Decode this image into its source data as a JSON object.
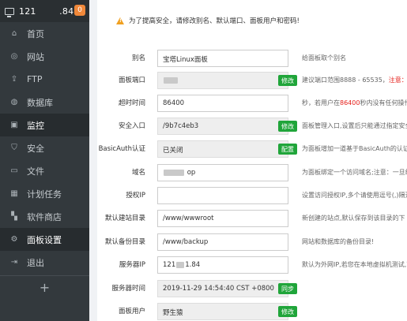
{
  "header": {
    "ip": "121        .84",
    "badge": "0"
  },
  "nav": [
    {
      "label": "首页",
      "icon": "home-icon"
    },
    {
      "label": "网站",
      "icon": "globe-icon"
    },
    {
      "label": "FTP",
      "icon": "upload-icon"
    },
    {
      "label": "数据库",
      "icon": "database-icon"
    },
    {
      "label": "监控",
      "icon": "monitor-icon"
    },
    {
      "label": "安全",
      "icon": "shield-icon"
    },
    {
      "label": "文件",
      "icon": "folder-icon"
    },
    {
      "label": "计划任务",
      "icon": "calendar-icon"
    },
    {
      "label": "软件商店",
      "icon": "grid-icon"
    },
    {
      "label": "面板设置",
      "icon": "gear-icon"
    },
    {
      "label": "退出",
      "icon": "logout-icon"
    }
  ],
  "add_symbol": "+",
  "warning": "为了提高安全，请修改别名、默认端口、面板用户和密码!",
  "form": {
    "alias": {
      "label": "别名",
      "value": "宝塔Linux面板",
      "hint": "给面板取个别名"
    },
    "port": {
      "label": "面板端口",
      "value": "",
      "button": "修改",
      "hint": "建议端口范围8888 - 65535，",
      "hint_red": "注意：有"
    },
    "timeout": {
      "label": "超时时间",
      "value": "86400",
      "hint_a": "秒，若用户在",
      "hint_red": "86400",
      "hint_b": "秒内没有任何操作，"
    },
    "entry": {
      "label": "安全入口",
      "value": "/9b7c4eb3",
      "button": "修改",
      "hint": "面板管理入口,设置后只能通过指定安全"
    },
    "basicauth": {
      "label": "BasicAuth认证",
      "value": "已关闭",
      "button": "配置",
      "hint": "为面板增加一道基于BasicAuth的认证"
    },
    "domain": {
      "label": "域名",
      "value": "op",
      "hint": "为面板绑定一个访问域名;注意：一旦绑"
    },
    "auth_ip": {
      "label": "授权IP",
      "value": "",
      "hint": "设置访问授权IP,多个请使用逗号(,)隔开"
    },
    "site_dir": {
      "label": "默认建站目录",
      "value": "/www/wwwroot",
      "hint": "新创建的站点,默认保存到该目录的下"
    },
    "backup_dir": {
      "label": "默认备份目录",
      "value": "/www/backup",
      "hint": "网站和数据库的备份目录!"
    },
    "server_ip": {
      "label": "服务器IP",
      "value_a": "121",
      "value_b": "1.84",
      "hint": "默认为外网IP,若您在本地虚拟机测试,可"
    },
    "server_time": {
      "label": "服务器时间",
      "value": "2019-11-29 14:54:40 CST +0800",
      "button": "同步"
    },
    "panel_user": {
      "label": "面板用户",
      "value": "野生猿",
      "button": "修改"
    }
  },
  "colors": {
    "sidebar_bg": "#33393d",
    "green_button": "#20a53a",
    "badge": "#f0883a",
    "red_text": "#e5201b"
  }
}
